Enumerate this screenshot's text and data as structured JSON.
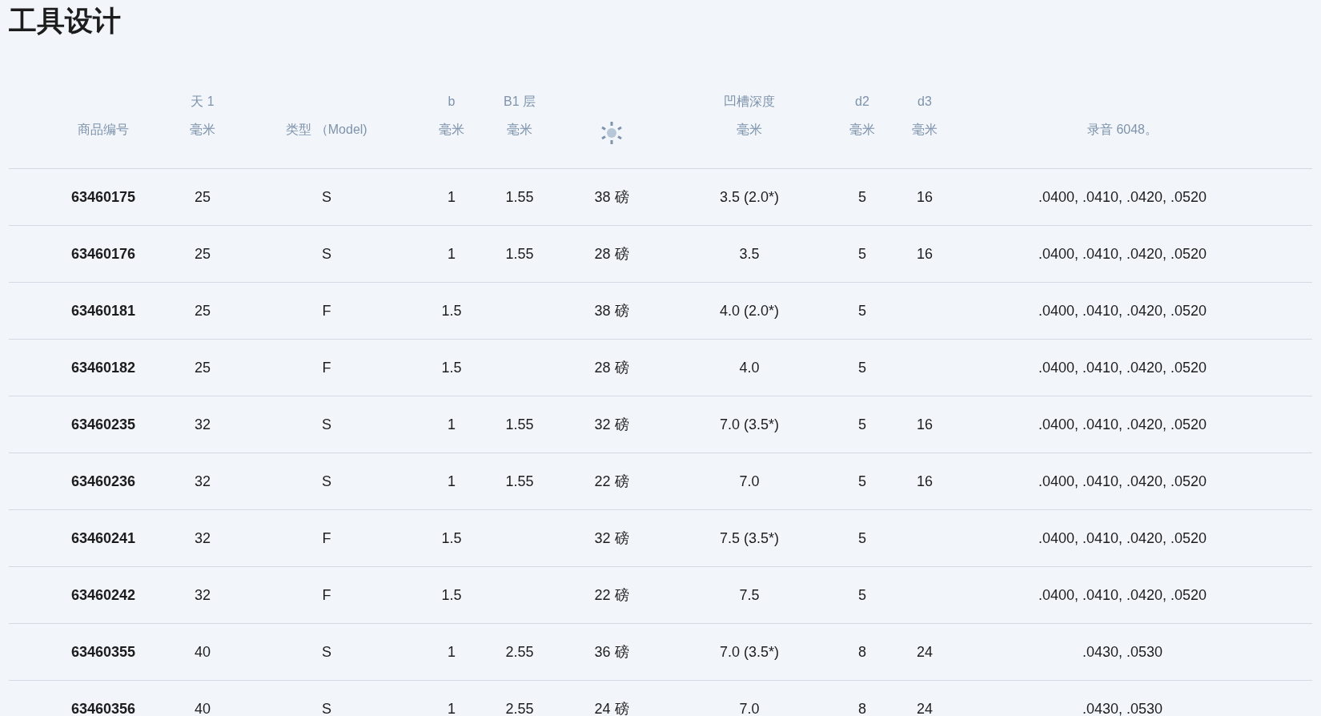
{
  "title": "工具设计",
  "table": {
    "columns": [
      {
        "kind": "text",
        "label": "商品编号"
      },
      {
        "kind": "text",
        "label_top": "天 1",
        "label": "毫米"
      },
      {
        "kind": "text",
        "label": "类型 （Model)"
      },
      {
        "kind": "text",
        "label_top": "b",
        "label": "毫米"
      },
      {
        "kind": "text",
        "label_top": "B1 层",
        "label": "毫米"
      },
      {
        "kind": "icon"
      },
      {
        "kind": "text",
        "label_top": "凹槽深度",
        "label": "毫米"
      },
      {
        "kind": "text",
        "label_top": "d2",
        "label": "毫米"
      },
      {
        "kind": "text",
        "label_top": "d3",
        "label": "毫米"
      },
      {
        "kind": "text",
        "label": "录音 6048。"
      }
    ],
    "rows": [
      [
        "63460175",
        "25",
        "S",
        "1",
        "1.55",
        "38 磅",
        "3.5 (2.0*)",
        "5",
        "16",
        ".0400, .0410, .0420, .0520"
      ],
      [
        "63460176",
        "25",
        "S",
        "1",
        "1.55",
        "28 磅",
        "3.5",
        "5",
        "16",
        ".0400, .0410, .0420, .0520"
      ],
      [
        "63460181",
        "25",
        "F",
        "1.5",
        null,
        "38 磅",
        "4.0 (2.0*)",
        "5",
        null,
        ".0400, .0410, .0420, .0520"
      ],
      [
        "63460182",
        "25",
        "F",
        "1.5",
        null,
        "28 磅",
        "4.0",
        "5",
        null,
        ".0400, .0410, .0420, .0520"
      ],
      [
        "63460235",
        "32",
        "S",
        "1",
        "1.55",
        "32 磅",
        "7.0 (3.5*)",
        "5",
        "16",
        ".0400, .0410, .0420, .0520"
      ],
      [
        "63460236",
        "32",
        "S",
        "1",
        "1.55",
        "22 磅",
        "7.0",
        "5",
        "16",
        ".0400, .0410, .0420, .0520"
      ],
      [
        "63460241",
        "32",
        "F",
        "1.5",
        null,
        "32 磅",
        "7.5 (3.5*)",
        "5",
        null,
        ".0400, .0410, .0420, .0520"
      ],
      [
        "63460242",
        "32",
        "F",
        "1.5",
        null,
        "22 磅",
        "7.5",
        "5",
        null,
        ".0400, .0410, .0420, .0520"
      ],
      [
        "63460355",
        "40",
        "S",
        "1",
        "2.55",
        "36 磅",
        "7.0 (3.5*)",
        "8",
        "24",
        ".0430, .0530"
      ],
      [
        "63460356",
        "40",
        "S",
        "1",
        "2.55",
        "24 磅",
        "7.0",
        "8",
        "24",
        ".0430, .0530"
      ]
    ]
  }
}
